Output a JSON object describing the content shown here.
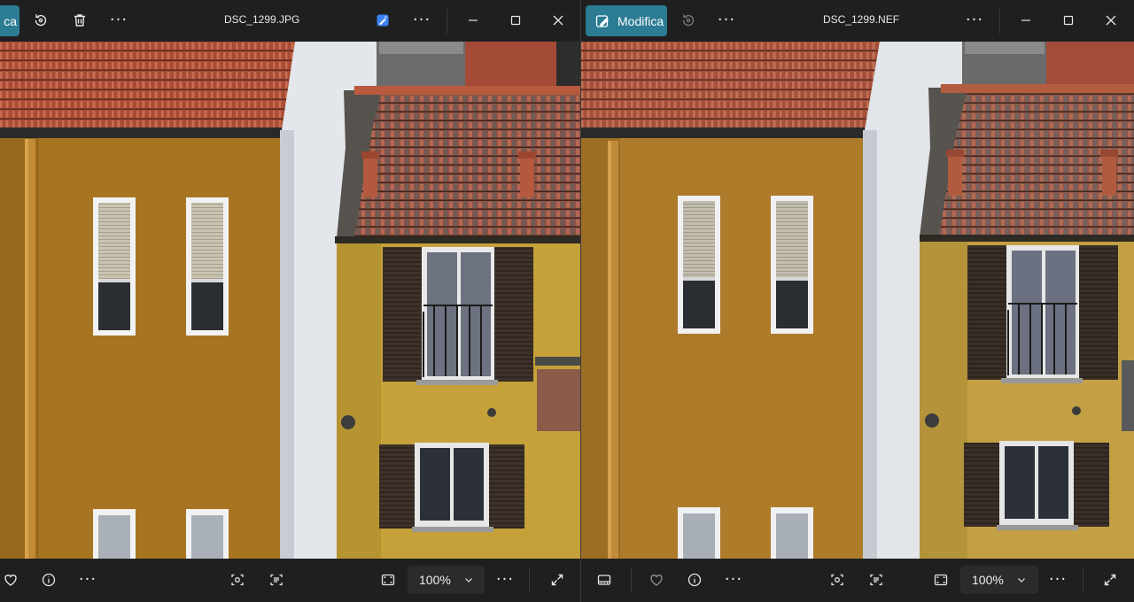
{
  "left": {
    "edit_label": "ca",
    "filename": "DSC_1299.JPG",
    "zoom": "100%",
    "more_glyph": "···"
  },
  "right": {
    "edit_label": "Modifica",
    "filename": "DSC_1299.NEF",
    "zoom": "100%",
    "more_glyph": "···"
  },
  "colors": {
    "accent": "#2c7c94",
    "chrome": "#1f1f1f",
    "ochre_wall": "#b58128",
    "yellow_wall": "#c9a43a",
    "roof_tile": "#b5553a",
    "white_wall": "#e4e7ec"
  },
  "icons": [
    "rotate-icon",
    "trash-icon",
    "more-icon",
    "image-enhance-icon",
    "minimize-icon",
    "maximize-icon",
    "close-icon",
    "heart-icon",
    "info-icon",
    "scan-icon",
    "text-scan-icon",
    "fit-icon",
    "chevron-down-icon",
    "expand-icon",
    "filmstrip-icon"
  ]
}
